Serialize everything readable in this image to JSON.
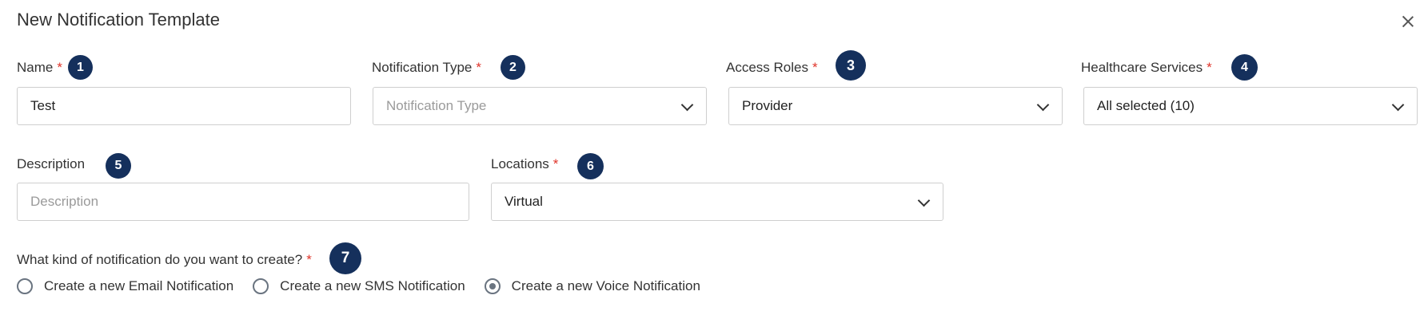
{
  "dialog": {
    "title": "New Notification Template"
  },
  "fields": {
    "name": {
      "label": "Name",
      "required": "*",
      "badge": "1",
      "value": "Test"
    },
    "notification_type": {
      "label": "Notification Type",
      "required": "*",
      "badge": "2",
      "placeholder": "Notification Type"
    },
    "access_roles": {
      "label": "Access Roles",
      "required": "*",
      "badge": "3",
      "value": "Provider"
    },
    "healthcare_services": {
      "label": "Healthcare Services",
      "required": "*",
      "badge": "4",
      "value": "All selected (10)"
    },
    "description": {
      "label": "Description",
      "badge": "5",
      "placeholder": "Description",
      "value": ""
    },
    "locations": {
      "label": "Locations",
      "required": "*",
      "badge": "6",
      "value": "Virtual"
    }
  },
  "notification_kind": {
    "question": "What kind of notification do you want to create?",
    "required": "*",
    "badge": "7",
    "options": [
      {
        "label": "Create a new Email Notification",
        "selected": false
      },
      {
        "label": "Create a new SMS Notification",
        "selected": false
      },
      {
        "label": "Create a new Voice Notification",
        "selected": true
      }
    ]
  },
  "colors": {
    "badge": "#15305c",
    "required": "#e0342a",
    "border": "#cfcfcf"
  }
}
